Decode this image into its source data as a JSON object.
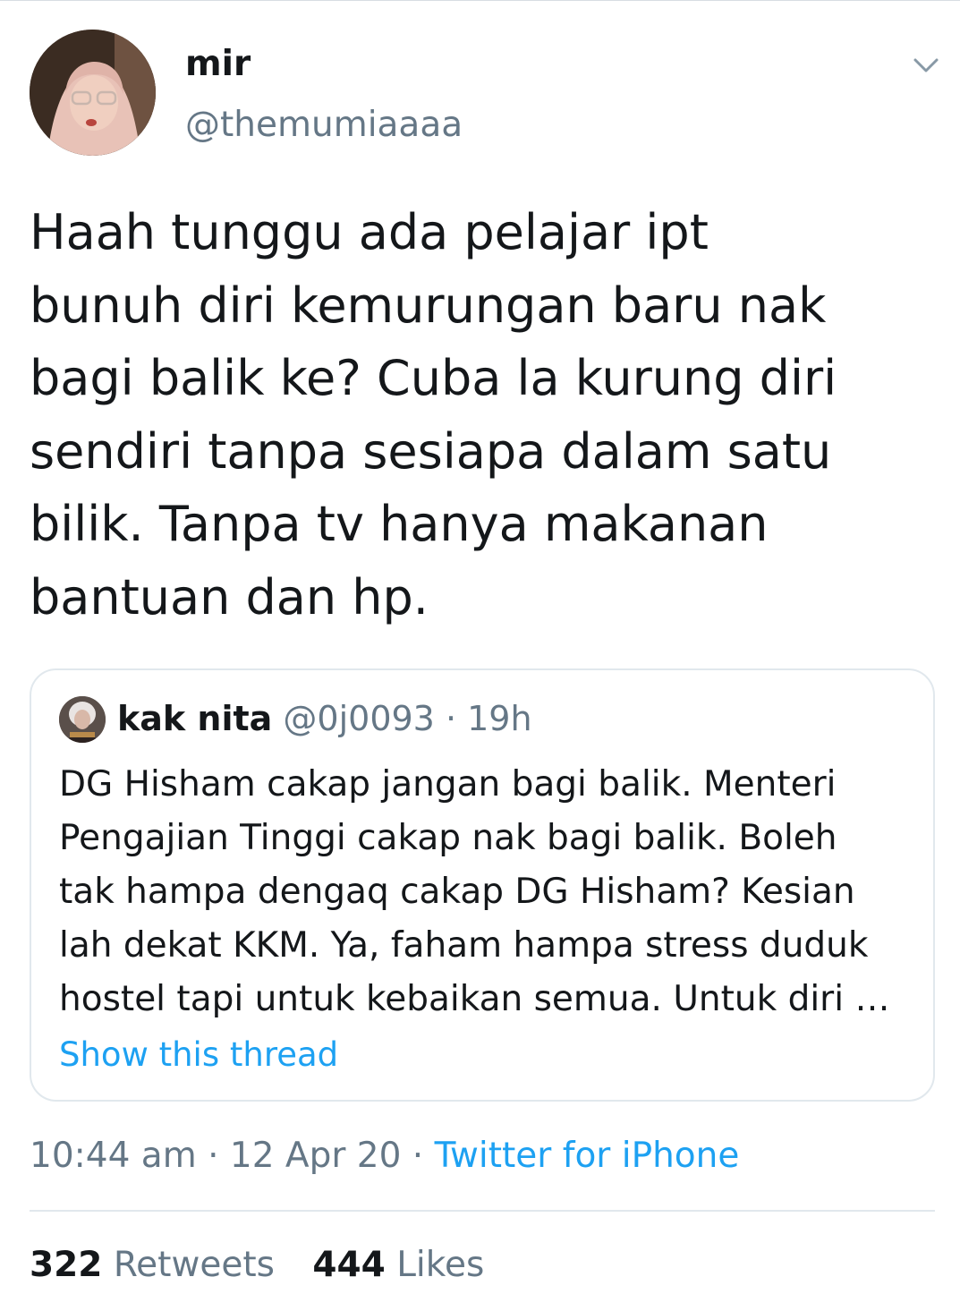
{
  "user": {
    "display_name": "mir",
    "handle": "@themumiaaaa"
  },
  "tweet": {
    "lines": [
      "Haah tunggu ada pelajar ipt",
      "bunuh diri kemurungan baru nak",
      "bagi balik ke? Cuba la kurung diri",
      "sendiri tanpa sesiapa dalam satu",
      "bilik. Tanpa tv hanya makanan",
      "bantuan dan hp."
    ]
  },
  "quoted_tweet": {
    "name": "kak nita",
    "handle": "@0j0093",
    "separator": " · ",
    "time": "19h",
    "lines": [
      "DG Hisham cakap jangan bagi balik. Menteri",
      "Pengajian Tinggi cakap nak bagi balik. Boleh",
      "tak hampa dengaq cakap DG Hisham? Kesian",
      "lah dekat KKM. Ya, faham hampa stress duduk",
      "hostel tapi untuk kebaikan semua. Untuk diri …"
    ],
    "show_thread": "Show this thread"
  },
  "meta": {
    "time": "10:44 am",
    "separator": " · ",
    "date": "12 Apr 20",
    "source": "Twitter for iPhone"
  },
  "stats": {
    "retweets_count": "322",
    "retweets_label": "Retweets",
    "likes_count": "444",
    "likes_label": "Likes"
  },
  "colors": {
    "link": "#1da1f2",
    "secondary_text": "#657786",
    "primary_text": "#14171a",
    "border": "#e1e8ed"
  },
  "icons": {
    "menu": "chevron-down-icon"
  }
}
